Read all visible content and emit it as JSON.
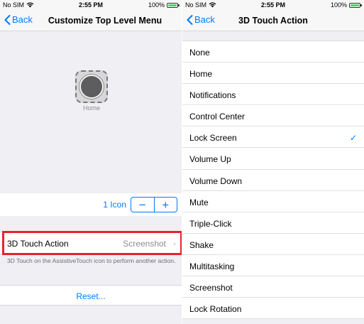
{
  "status_bar": {
    "carrier": "No SIM",
    "time": "2:55 PM",
    "battery": "100%"
  },
  "colors": {
    "accent": "#007aff",
    "highlight": "#e8222e",
    "battery_fill": "#4cd964"
  },
  "left": {
    "nav": {
      "back_label": "Back",
      "title": "Customize Top Level Menu"
    },
    "preview": {
      "icon": "home-button-icon",
      "label": "Home"
    },
    "icon_count": "1 Icon",
    "stepper": {
      "minus": "−",
      "plus": "+"
    },
    "action_row": {
      "label": "3D Touch Action",
      "value": "Screenshot"
    },
    "footnote": "3D Touch on the AssistiveTouch icon to perform another action.",
    "reset_label": "Reset..."
  },
  "right": {
    "nav": {
      "back_label": "Back",
      "title": "3D Touch Action"
    },
    "items": [
      {
        "label": "None"
      },
      {
        "label": "Home"
      },
      {
        "label": "Notifications"
      },
      {
        "label": "Control Center"
      },
      {
        "label": "Lock Screen",
        "selected": "✓"
      },
      {
        "label": "Volume Up"
      },
      {
        "label": "Volume Down"
      },
      {
        "label": "Mute"
      },
      {
        "label": "Triple-Click"
      },
      {
        "label": "Shake"
      },
      {
        "label": "Multitasking"
      },
      {
        "label": "Screenshot"
      },
      {
        "label": "Lock Rotation"
      }
    ]
  }
}
